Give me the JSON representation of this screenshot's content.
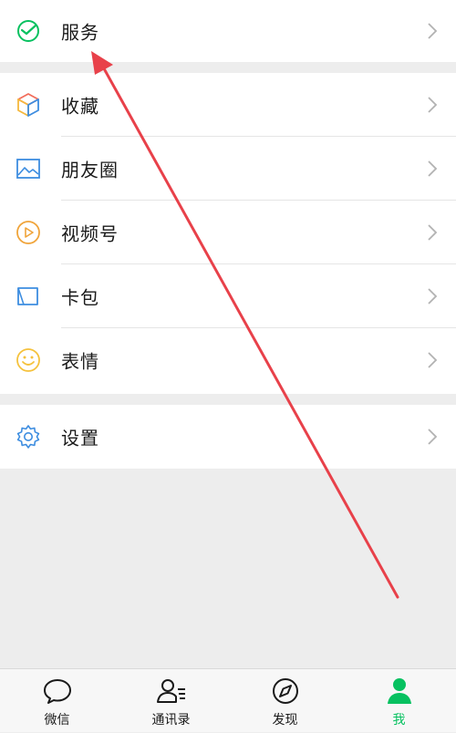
{
  "menu": {
    "services": "服务",
    "favorites": "收藏",
    "moments": "朋友圈",
    "channels": "视频号",
    "cards": "卡包",
    "stickers": "表情",
    "settings": "设置"
  },
  "icons": {
    "services": "wechat-pay-check-icon",
    "favorites": "cube-icon",
    "moments": "picture-icon",
    "channels": "play-circle-icon",
    "cards": "card-wallet-icon",
    "stickers": "smiley-icon",
    "settings": "gear-icon",
    "chevron": "chevron-right-icon"
  },
  "tabbar": {
    "chats": "微信",
    "contacts": "通讯录",
    "discover": "发现",
    "me": "我"
  },
  "colors": {
    "accent": "#07c160",
    "annotation_arrow": "#e8414a",
    "background": "#ededed"
  }
}
